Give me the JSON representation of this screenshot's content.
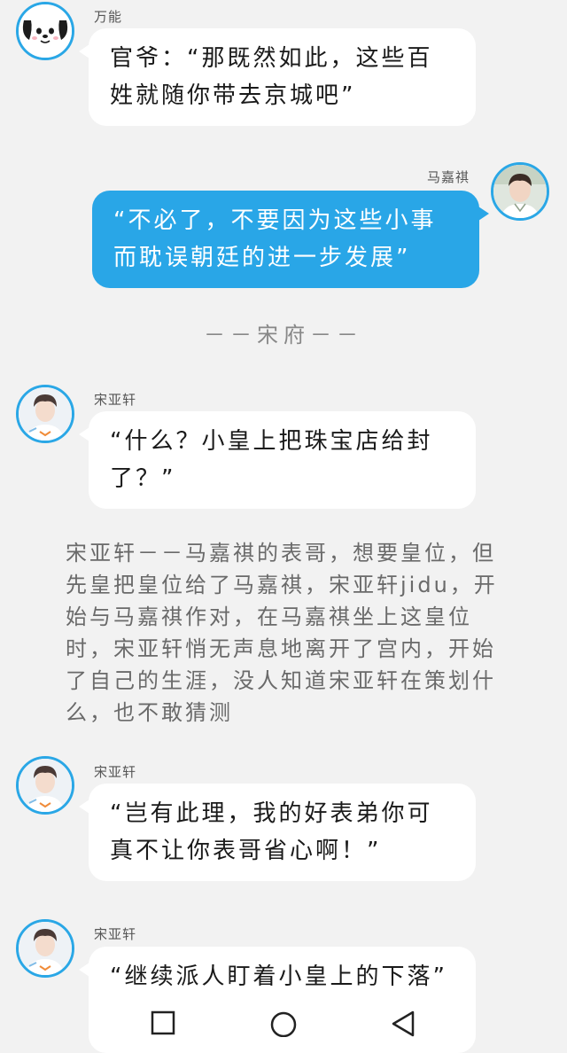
{
  "messages": [
    {
      "side": "left",
      "sender": "万能",
      "text": "官爷：“那既然如此，这些百姓就随你带去京城吧”",
      "avatar": "cartoon-dog-avatar"
    },
    {
      "side": "right",
      "sender": "马嘉祺",
      "text": "“不必了，不要因为这些小事而耽误朝廷的进一步发展”",
      "avatar": "young-man-avatar"
    },
    {
      "side": "left",
      "sender": "宋亚轩",
      "text": "“什么？小皇上把珠宝店给封了？”",
      "avatar": "young-man-avatar"
    },
    {
      "side": "left",
      "sender": "宋亚轩",
      "text": "“岂有此理，我的好表弟你可真不让你表哥省心啊！”",
      "avatar": "young-man-avatar"
    },
    {
      "side": "left",
      "sender": "宋亚轩",
      "text": "“继续派人盯着小皇上的下落”",
      "avatar": "young-man-avatar"
    }
  ],
  "separator": "－－宋府－－",
  "narration": "宋亚轩－－马嘉祺的表哥，想要皇位，但先皇把皇位给了马嘉祺，宋亚轩jidu，开始与马嘉祺作对，在马嘉祺坐上这皇位时，宋亚轩悄无声息地离开了宫内，开始了自己的生涯，没人知道宋亚轩在策划什么，也不敢猜测",
  "navbar": [
    "square-icon",
    "circle-icon",
    "triangle-back-icon"
  ],
  "colors": {
    "background": "#f2f2f2",
    "accent": "#29a6e7",
    "bubble_left": "#ffffff"
  }
}
